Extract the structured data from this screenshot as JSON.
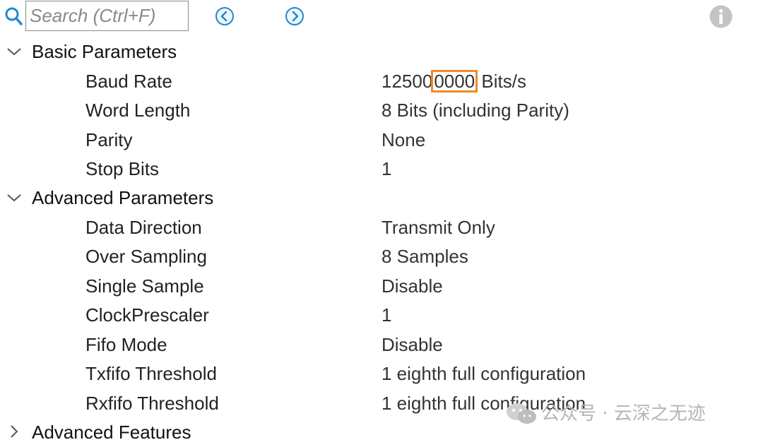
{
  "search": {
    "placeholder": "Search (Ctrl+F)",
    "value": ""
  },
  "icons": {
    "search": "search-icon",
    "prev": "chevron-left-circle-icon",
    "next": "chevron-right-circle-icon",
    "info": "info-icon",
    "expanded": "chevron-down-icon",
    "collapsed": "chevron-right-icon"
  },
  "colors": {
    "accent": "#1e8ad0",
    "highlight": "#f08a2a",
    "info": "#bdbdbd"
  },
  "groups": [
    {
      "label": "Basic Parameters",
      "expanded": true,
      "params": [
        {
          "label": "Baud Rate",
          "value_prefix": "12500",
          "value_highlight": "0000",
          "value_suffix": " Bits/s"
        },
        {
          "label": "Word Length",
          "value": "8 Bits (including Parity)"
        },
        {
          "label": "Parity",
          "value": "None"
        },
        {
          "label": "Stop Bits",
          "value": "1"
        }
      ]
    },
    {
      "label": "Advanced Parameters",
      "expanded": true,
      "params": [
        {
          "label": "Data Direction",
          "value": "Transmit Only"
        },
        {
          "label": "Over Sampling",
          "value": "8 Samples"
        },
        {
          "label": "Single Sample",
          "value": "Disable"
        },
        {
          "label": "ClockPrescaler",
          "value": "1"
        },
        {
          "label": "Fifo Mode",
          "value": "Disable"
        },
        {
          "label": "Txfifo Threshold",
          "value": "1 eighth full configuration"
        },
        {
          "label": "Rxfifo Threshold",
          "value": "1 eighth full configuration"
        }
      ]
    },
    {
      "label": "Advanced Features",
      "expanded": false,
      "params": []
    }
  ],
  "watermark": {
    "text": "公众号 · 云深之无迹"
  }
}
